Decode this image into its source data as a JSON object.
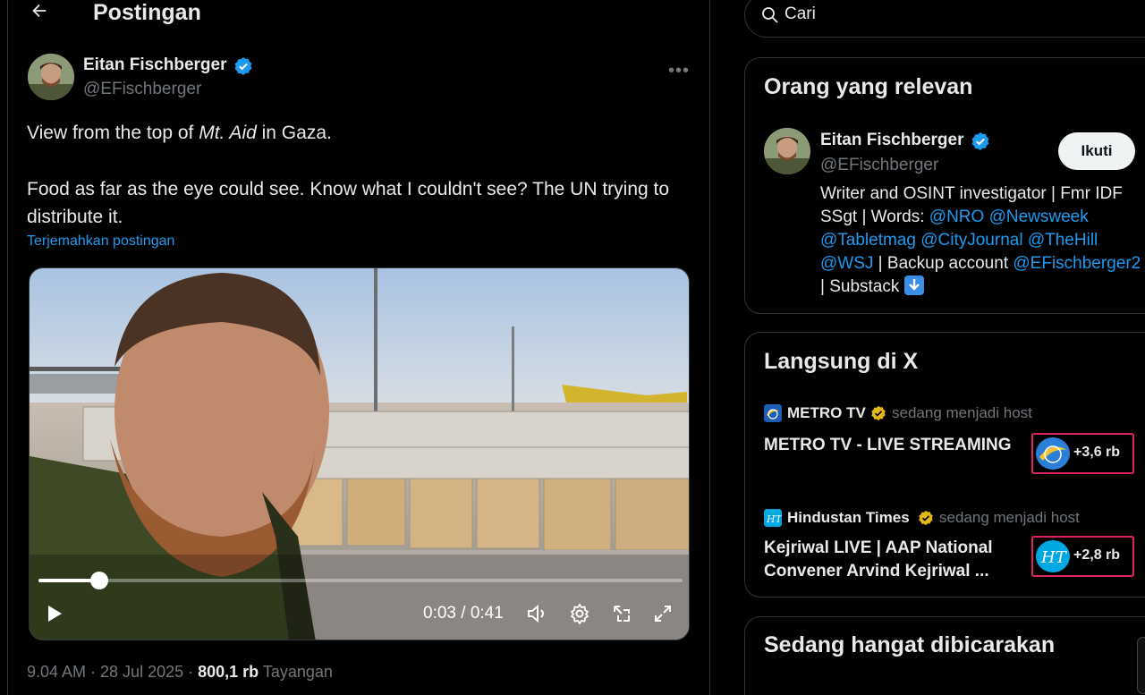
{
  "header": {
    "title": "Postingan"
  },
  "post": {
    "author_name": "Eitan Fischberger",
    "author_handle": "@EFischberger",
    "text_line1_pre": "View from the top of ",
    "text_line1_italic": "Mt. Aid",
    "text_line1_post": " in Gaza.",
    "text_line2": "Food as far as the eye could see. Know what I couldn't see? The UN trying to distribute it.",
    "translate_label": "Terjemahkan postingan",
    "video": {
      "timecode": "0:03 / 0:41",
      "progress": 0.095
    },
    "time": "9.04 AM · 28 Jul 2025 · ",
    "views_count": "800,1 rb",
    "views_label": " Tayangan"
  },
  "search": {
    "placeholder": "Cari"
  },
  "relevant": {
    "title": "Orang yang relevan",
    "name": "Eitan Fischberger",
    "handle": "@EFischberger",
    "follow_label": "Ikuti",
    "bio_1": "Writer and OSINT investigator | Fmr IDF SSgt | Words: ",
    "bio_m1": "@NRO",
    "bio_m2": "@Newsweek",
    "bio_m3": "@Tabletmag",
    "bio_m4": "@CityJournal",
    "bio_m5": "@TheHill",
    "bio_m6": "@WSJ",
    "bio_2": " | Backup account ",
    "bio_m7": "@EFischberger2",
    "bio_3": " | Substack "
  },
  "live": {
    "title": "Langsung di X",
    "items": [
      {
        "host": "METRO TV",
        "status": "sedang menjadi host",
        "title": "METRO TV - LIVE STREAMING",
        "count": "+3,6 rb"
      },
      {
        "host": "Hindustan Times",
        "status": "sedang menjadi host",
        "title": "Kejriwal LIVE | AAP National Convener Arvind Kejriwal ...",
        "count": "+2,8 rb"
      }
    ]
  },
  "trending": {
    "title": "Sedang hangat dibicarakan"
  },
  "colors": {
    "accent": "#1d9bf0",
    "verified": "#1d9bf0",
    "gold_verified": "#e2b719",
    "live_border": "#e0245e"
  }
}
